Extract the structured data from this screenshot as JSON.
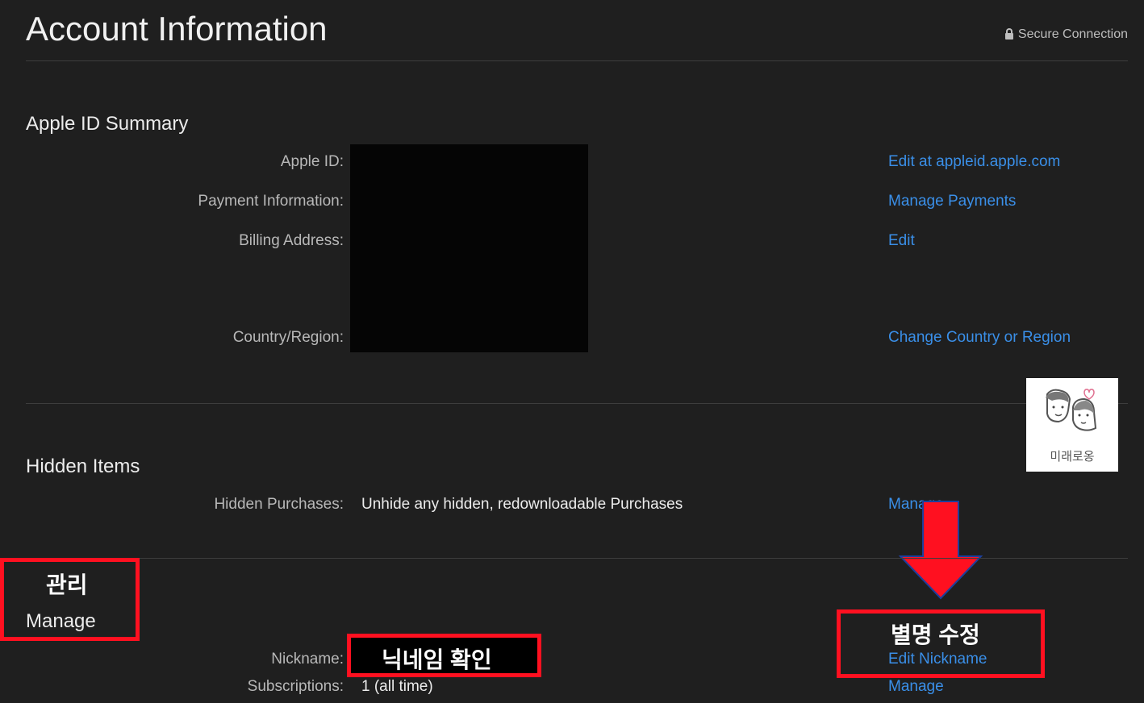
{
  "header": {
    "title": "Account Information",
    "secure_label": "Secure Connection"
  },
  "summary": {
    "title": "Apple ID Summary",
    "rows": [
      {
        "label": "Apple ID:",
        "link": "Edit at appleid.apple.com"
      },
      {
        "label": "Payment Information:",
        "link": "Manage Payments"
      },
      {
        "label": "Billing Address:",
        "link": "Edit"
      },
      {
        "label": "Country/Region:",
        "link": "Change Country or Region"
      }
    ]
  },
  "hidden": {
    "title": "Hidden Items",
    "row": {
      "label": "Hidden Purchases:",
      "value": "Unhide any hidden, redownloadable Purchases",
      "link": "Manage"
    }
  },
  "manage": {
    "title": "Manage",
    "rows": [
      {
        "label": "Nickname:",
        "link": "Edit Nickname"
      },
      {
        "label": "Subscriptions:",
        "value": "1 (all time)",
        "link": "Manage"
      }
    ]
  },
  "annotations": {
    "manage_korean": "관리",
    "nickname_korean": "닉네임 확인",
    "edit_nickname_korean": "별명 수정",
    "watermark_text": "미래로옹",
    "highlight_color": "#ff1020"
  }
}
